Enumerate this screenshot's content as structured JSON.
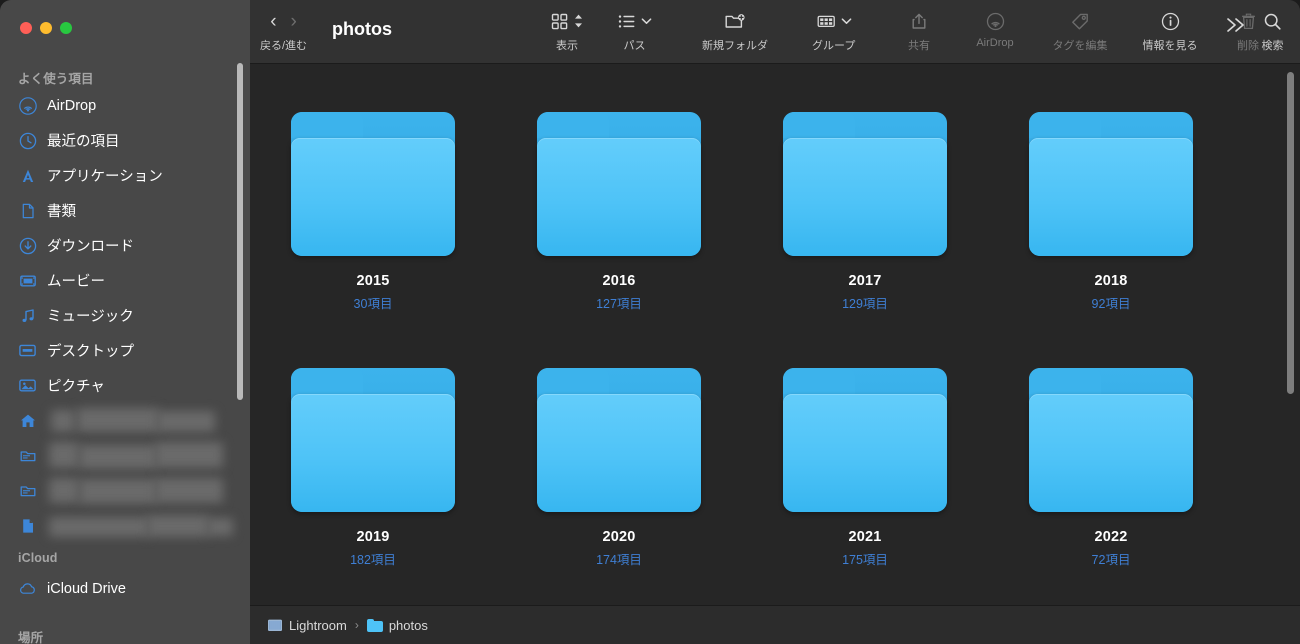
{
  "window": {
    "title": "photos",
    "traffic_lights": [
      "close",
      "minimize",
      "zoom"
    ]
  },
  "toolbar": {
    "nav": {
      "caption": "戻る/進む",
      "back_icon": "chevron-left-icon",
      "forward_icon": "chevron-right-icon"
    },
    "items": [
      {
        "key": "view",
        "caption": "表示",
        "icon": "grid-view-icon",
        "chevron": "updown",
        "disabled": false
      },
      {
        "key": "path",
        "caption": "パス",
        "icon": "list-path-icon",
        "chevron": "down",
        "disabled": false
      },
      {
        "key": "new_folder",
        "caption": "新規フォルダ",
        "icon": "new-folder-icon",
        "chevron": "none",
        "disabled": false
      },
      {
        "key": "group",
        "caption": "グループ",
        "icon": "group-icon",
        "chevron": "down",
        "disabled": false
      },
      {
        "key": "share",
        "caption": "共有",
        "icon": "share-icon",
        "chevron": "none",
        "disabled": true
      },
      {
        "key": "airdrop",
        "caption": "AirDrop",
        "icon": "airdrop-icon",
        "chevron": "none",
        "disabled": true
      },
      {
        "key": "tags",
        "caption": "タグを編集",
        "icon": "tag-icon",
        "chevron": "none",
        "disabled": true
      },
      {
        "key": "info",
        "caption": "情報を見る",
        "icon": "info-circle-icon",
        "chevron": "none",
        "disabled": false
      },
      {
        "key": "delete",
        "caption": "削除",
        "icon": "trash-icon",
        "chevron": "none",
        "disabled": true
      },
      {
        "key": "overflow",
        "caption": "",
        "icon": "chevron-double-right-icon",
        "chevron": "none",
        "disabled": false
      },
      {
        "key": "search",
        "caption": "検索",
        "icon": "search-icon",
        "chevron": "none",
        "disabled": false
      }
    ]
  },
  "sidebar": {
    "sections": [
      {
        "title": "よく使う項目",
        "items": [
          {
            "label": "AirDrop",
            "icon": "airdrop-icon",
            "redacted": false
          },
          {
            "label": "最近の項目",
            "icon": "recents-clock-icon",
            "redacted": false
          },
          {
            "label": "アプリケーション",
            "icon": "applications-icon",
            "redacted": false
          },
          {
            "label": "書類",
            "icon": "documents-icon",
            "redacted": false
          },
          {
            "label": "ダウンロード",
            "icon": "downloads-icon",
            "redacted": false
          },
          {
            "label": "ムービー",
            "icon": "movies-icon",
            "redacted": false
          },
          {
            "label": "ミュージック",
            "icon": "music-icon",
            "redacted": false
          },
          {
            "label": "デスクトップ",
            "icon": "desktop-icon",
            "redacted": false
          },
          {
            "label": "ピクチャ",
            "icon": "pictures-icon",
            "redacted": false
          },
          {
            "label": "",
            "icon": "home-icon",
            "redacted": true
          },
          {
            "label": "",
            "icon": "folder-icon",
            "redacted": true
          },
          {
            "label": "",
            "icon": "folder-icon",
            "redacted": true
          },
          {
            "label": "",
            "icon": "document-icon",
            "redacted": true
          }
        ]
      },
      {
        "title": "iCloud",
        "items": [
          {
            "label": "iCloud Drive",
            "icon": "icloud-icon",
            "redacted": false
          }
        ]
      },
      {
        "title": "場所",
        "items": []
      }
    ]
  },
  "main": {
    "folders": [
      {
        "name": "2015",
        "count": "30項目",
        "icon": "folder-icon"
      },
      {
        "name": "2016",
        "count": "127項目",
        "icon": "folder-icon"
      },
      {
        "name": "2017",
        "count": "129項目",
        "icon": "folder-icon"
      },
      {
        "name": "2018",
        "count": "92項目",
        "icon": "folder-icon"
      },
      {
        "name": "2019",
        "count": "182項目",
        "icon": "folder-icon"
      },
      {
        "name": "2020",
        "count": "174項目",
        "icon": "folder-icon"
      },
      {
        "name": "2021",
        "count": "175項目",
        "icon": "folder-icon"
      },
      {
        "name": "2022",
        "count": "72項目",
        "icon": "folder-icon"
      }
    ]
  },
  "pathbar": {
    "crumbs": [
      {
        "label": "Lightroom",
        "icon": "hard-drive-icon"
      },
      {
        "label": "photos",
        "icon": "folder-icon"
      }
    ],
    "separator": "›"
  },
  "colors": {
    "sidebar_bg": "#484848",
    "content_bg": "#262626",
    "toolbar_bg": "#323232",
    "pathbar_bg": "#2c2c2c",
    "folder_blue": "#4ec3f7",
    "folder_blue_dark": "#2fa3e0",
    "count_text": "#3f7fd4"
  }
}
